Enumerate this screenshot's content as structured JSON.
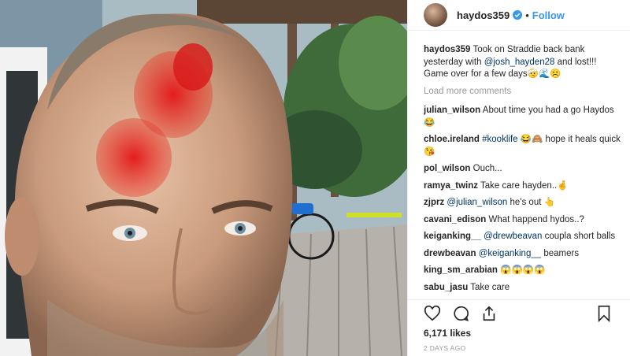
{
  "post": {
    "username": "haydos359",
    "follow_label": "Follow",
    "caption": {
      "user": "haydos359",
      "text1": "Took on Straddie back bank yesterday with ",
      "mention": "@josh_hayden28",
      "text2": " and lost!!! Game over for a few days🤕🌊☹️"
    },
    "load_more": "Load more comments",
    "comments": [
      {
        "user": "julian_wilson",
        "text": "About time you had a go Haydos 😂"
      },
      {
        "user": "chloe.ireland",
        "mention": "#kooklife",
        "text": " 😂🙈 hope it heals quick 😘"
      },
      {
        "user": "pol_wilson",
        "text": "Ouch..."
      },
      {
        "user": "ramya_twinz",
        "text": "Take care hayden..🤞"
      },
      {
        "user": "zjprz",
        "mention": "@julian_wilson",
        "text": " he's out 👆"
      },
      {
        "user": "cavani_edison",
        "text": "What happend hydos..?"
      },
      {
        "user": "keiganking__",
        "mention": "@drewbeavan",
        "text": " coupla short balls"
      },
      {
        "user": "drewbeavan",
        "mention": "@keiganking__",
        "text": " beamers"
      },
      {
        "user": "king_sm_arabian",
        "text": "😱😱😱😱"
      },
      {
        "user": "sabu_jasu",
        "text": "Take care"
      }
    ],
    "likes": "6,171 likes",
    "time": "2 DAYS AGO",
    "icons": [
      "heart-icon",
      "comment-icon",
      "share-icon",
      "bookmark-icon",
      "verified-icon"
    ],
    "colors": {
      "link": "#3897f0",
      "mention": "#003569",
      "muted": "#999999"
    }
  }
}
